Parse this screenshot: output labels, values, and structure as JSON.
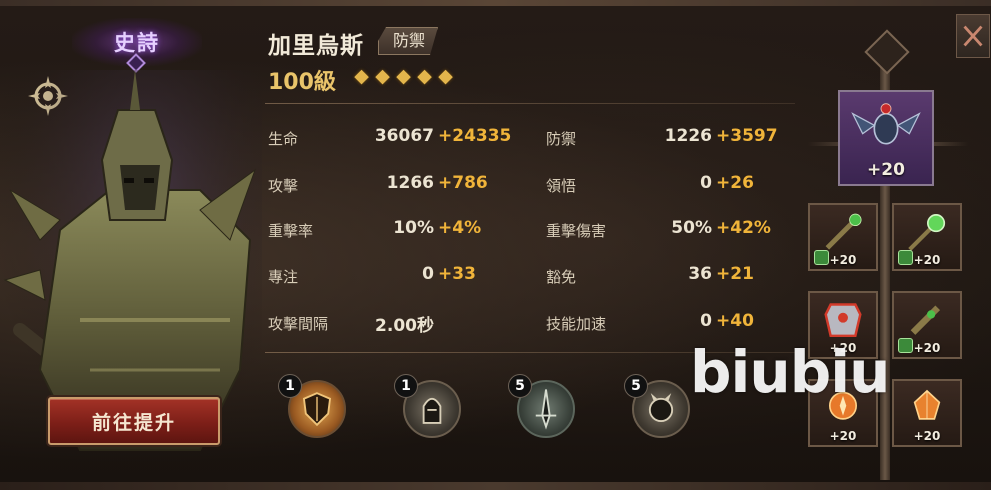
{
  "rarity": "史詩",
  "hero": {
    "name": "加里烏斯",
    "role": "防禦",
    "level": "100級",
    "stars": 5
  },
  "upgrade_button": "前往提升",
  "stats_left": [
    {
      "label": "生命",
      "base": "36067",
      "bonus": "+24335"
    },
    {
      "label": "攻擊",
      "base": "1266",
      "bonus": "+786"
    },
    {
      "label": "重擊率",
      "base": "10%",
      "bonus": "+4%"
    },
    {
      "label": "專注",
      "base": "0",
      "bonus": "+33"
    },
    {
      "label": "攻擊間隔",
      "base": "2.00秒",
      "bonus": ""
    }
  ],
  "stats_right": [
    {
      "label": "防禦",
      "base": "1226",
      "bonus": "+3597"
    },
    {
      "label": "領悟",
      "base": "0",
      "bonus": "+26"
    },
    {
      "label": "重擊傷害",
      "base": "50%",
      "bonus": "+42%"
    },
    {
      "label": "豁免",
      "base": "36",
      "bonus": "+21"
    },
    {
      "label": "技能加速",
      "base": "0",
      "bonus": "+40"
    }
  ],
  "skills": [
    {
      "icon": "shield-skill-icon",
      "level": "1",
      "color": "#c9863a"
    },
    {
      "icon": "helmet-skill-icon",
      "level": "1",
      "color": "#6b6258"
    },
    {
      "icon": "blade-skill-icon",
      "level": "5",
      "color": "#5e6a60"
    },
    {
      "icon": "beast-skill-icon",
      "level": "5",
      "color": "#6a6258"
    }
  ],
  "equipment": {
    "main": {
      "icon": "beetle-relic-icon",
      "level": "+20"
    },
    "slots": [
      {
        "icon": "green-weapon-icon",
        "level": "+20",
        "locked": true
      },
      {
        "icon": "green-orb-staff-icon",
        "level": "+20",
        "locked": true
      },
      {
        "icon": "red-armor-icon",
        "level": "+20",
        "locked": false
      },
      {
        "icon": "green-gauntlet-icon",
        "level": "+20",
        "locked": true
      },
      {
        "icon": "fire-gem-icon",
        "level": "+20",
        "locked": false
      },
      {
        "icon": "fire-crystal-icon",
        "level": "+20",
        "locked": false
      }
    ]
  },
  "watermark": "biubiu"
}
